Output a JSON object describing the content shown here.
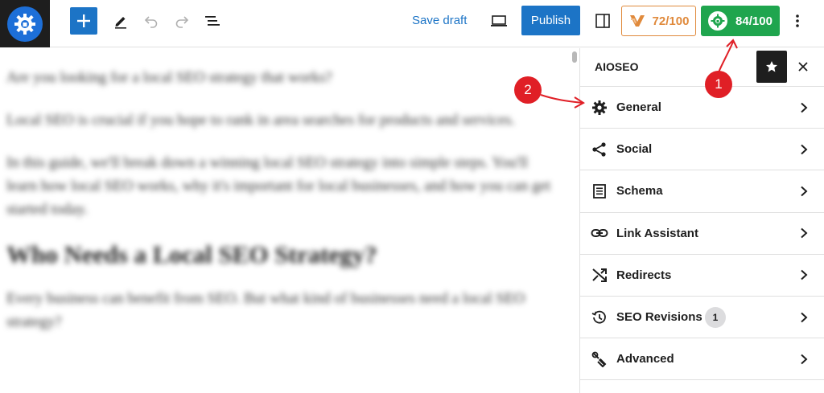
{
  "toolbar": {
    "save_draft": "Save draft",
    "publish": "Publish",
    "score_a": "72/100",
    "score_b": "84/100",
    "icons": [
      "add-block-icon",
      "pencil-icon",
      "undo-icon",
      "redo-icon",
      "list-view-icon",
      "preview-icon",
      "sidebar-icon",
      "kebab-icon"
    ]
  },
  "editor": {
    "paragraphs": [
      "Are you looking for a local SEO strategy that works?",
      "Local SEO is crucial if you hope to rank in area searches for products and services.",
      "In this guide, we'll break down a winning local SEO strategy into simple steps. You'll learn how local SEO works, why it's important for local businesses, and how you can get started today."
    ],
    "heading": "Who Needs a Local SEO Strategy?",
    "paragraph_last": "Every business can benefit from SEO. But what kind of businesses need a local SEO strategy?"
  },
  "sidebar": {
    "title": "AIOSEO",
    "items": [
      {
        "label": "General",
        "icon": "gear-icon"
      },
      {
        "label": "Social",
        "icon": "share-icon"
      },
      {
        "label": "Schema",
        "icon": "schema-icon"
      },
      {
        "label": "Link Assistant",
        "icon": "link-icon"
      },
      {
        "label": "Redirects",
        "icon": "redirect-icon"
      },
      {
        "label": "SEO Revisions",
        "icon": "history-icon",
        "badge": "1"
      },
      {
        "label": "Advanced",
        "icon": "wrench-icon"
      }
    ]
  },
  "annotations": {
    "one": "1",
    "two": "2"
  },
  "colors": {
    "accent": "#1c74c6",
    "score_a": "#e08a3c",
    "score_b": "#1fa54e",
    "annotation": "#e01f26"
  }
}
